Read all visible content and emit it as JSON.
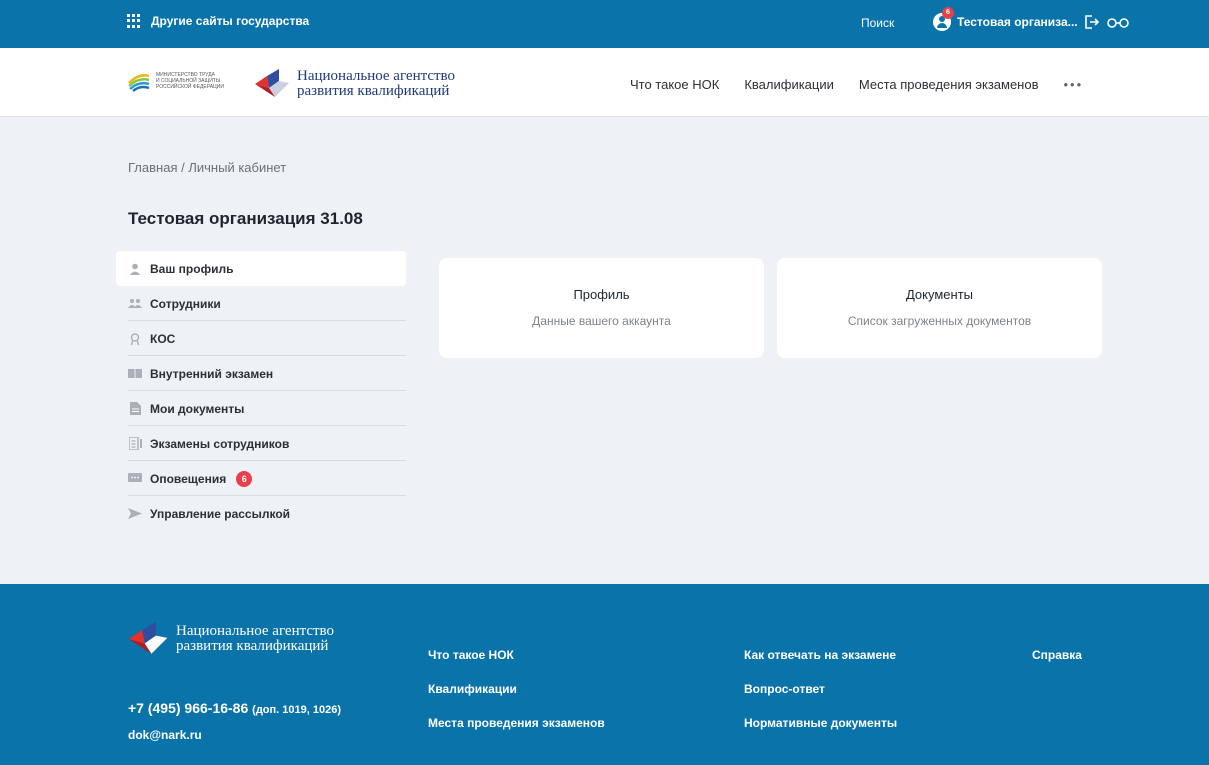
{
  "topbar": {
    "other_sites": "Другие сайты государства",
    "search": "Поиск",
    "user_name": "Тестовая организа...",
    "notif_count": "6"
  },
  "header": {
    "ministry_lines": [
      "Министерство труда",
      "и социальной защиты",
      "Российской Федерации"
    ],
    "agency_name_line1": "Национальное агентство",
    "agency_name_line2": "развития квалификаций",
    "nav": [
      "Что такое НОК",
      "Квалификации",
      "Места проведения экзаменов"
    ],
    "more": "•••"
  },
  "breadcrumb": {
    "home": "Главная",
    "sep": "/",
    "current": "Личный кабинет"
  },
  "org_title": "Тестовая организация 31.08",
  "sidebar": {
    "items": [
      {
        "label": "Ваш профиль",
        "icon": "user-icon"
      },
      {
        "label": "Сотрудники",
        "icon": "users-icon"
      },
      {
        "label": "КОС",
        "icon": "award-icon"
      },
      {
        "label": "Внутренний экзамен",
        "icon": "book-icon"
      },
      {
        "label": "Мои документы",
        "icon": "document-icon"
      },
      {
        "label": "Экзамены сотрудников",
        "icon": "list-icon"
      },
      {
        "label": "Оповещения",
        "icon": "message-icon",
        "badge": "6"
      },
      {
        "label": "Управление рассылкой",
        "icon": "send-icon"
      }
    ]
  },
  "cards": [
    {
      "title": "Профиль",
      "subtitle": "Данные вашего аккаунта"
    },
    {
      "title": "Документы",
      "subtitle": "Список загруженных документов"
    }
  ],
  "footer": {
    "agency_name_line1": "Национальное агентство",
    "agency_name_line2": "развития квалификаций",
    "phone": "+7 (495) 966-16-86",
    "phone_ext": "(доп. 1019, 1026)",
    "email": "dok@nark.ru",
    "col1": [
      "Что такое НОК",
      "Квалификации",
      "Места проведения экзаменов"
    ],
    "col2": [
      "Как отвечать на экзамене",
      "Вопрос-ответ",
      "Нормативные документы"
    ],
    "col3": [
      "Справка"
    ]
  },
  "colors": {
    "brand_blue": "#0a74aa",
    "badge_red": "#e8404a",
    "page_bg": "#eef1f5"
  }
}
